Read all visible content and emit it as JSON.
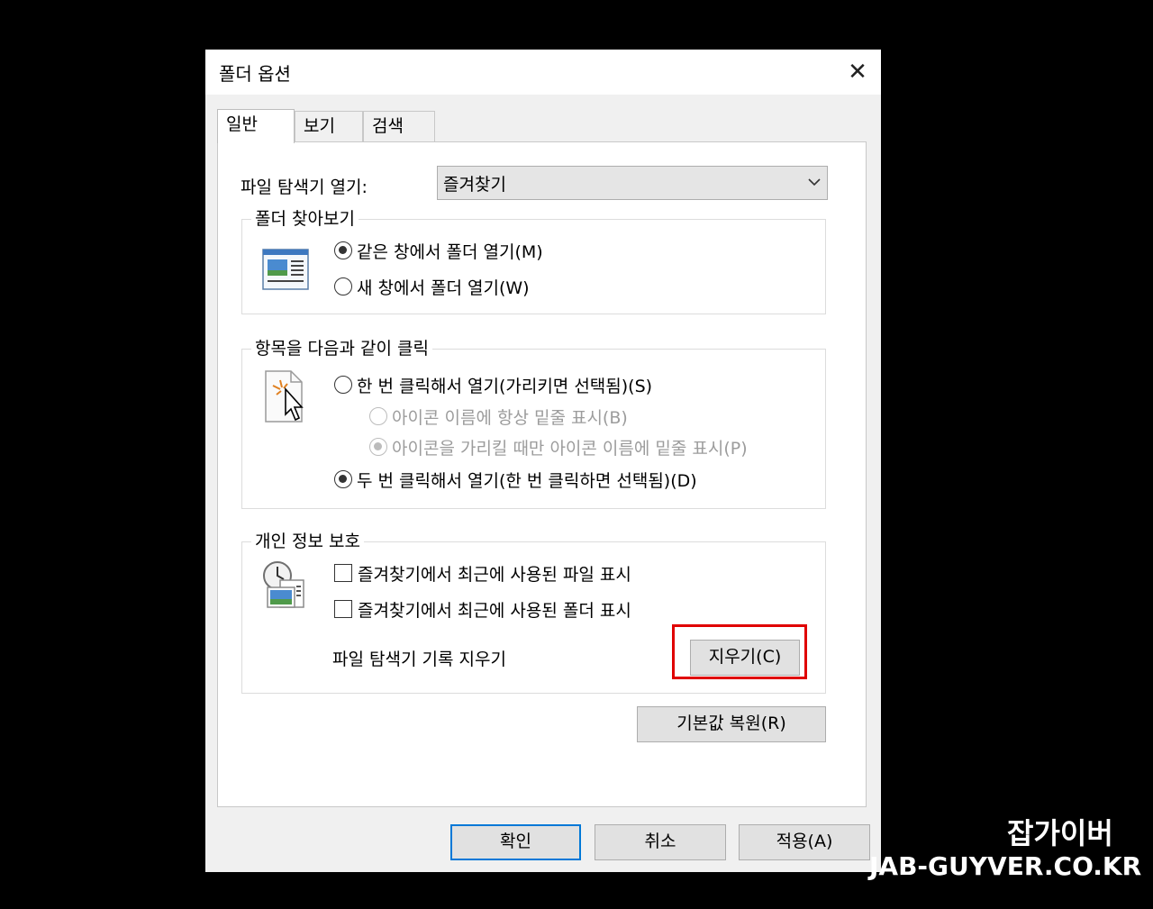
{
  "dialog": {
    "title": "폴더 옵션",
    "close_label": "✕"
  },
  "tabs": [
    "일반",
    "보기",
    "검색"
  ],
  "general": {
    "open_explorer_label": "파일 탐색기 열기:",
    "open_explorer_value": "즐겨찾기",
    "browse_group": {
      "legend": "폴더 찾아보기",
      "options": [
        "같은 창에서 폴더 열기(M)",
        "새 창에서 폴더 열기(W)"
      ],
      "selected_index": 0
    },
    "click_group": {
      "legend": "항목을 다음과 같이 클릭",
      "single_click": "한 번 클릭해서 열기(가리키면 선택됨)(S)",
      "underline_always": "아이콘 이름에 항상 밑줄 표시(B)",
      "underline_hover": "아이콘을 가리킬 때만 아이콘 이름에 밑줄 표시(P)",
      "double_click": "두 번 클릭해서 열기(한 번 클릭하면 선택됨)(D)",
      "selected": "double_click"
    },
    "privacy_group": {
      "legend": "개인 정보 보호",
      "show_recent_files": "즐겨찾기에서 최근에 사용된 파일 표시",
      "show_frequent_folders": "즐겨찾기에서 최근에 사용된 폴더 표시",
      "clear_history_label": "파일 탐색기 기록 지우기",
      "clear_button": "지우기(C)"
    },
    "restore_defaults": "기본값 복원(R)"
  },
  "footer": {
    "ok": "확인",
    "cancel": "취소",
    "apply": "적용(A)"
  },
  "watermark": {
    "line1": "잡가이버",
    "line2": "JAB-GUYVER.CO.KR"
  },
  "colors": {
    "highlight": "#e00000",
    "default_button_border": "#0078d7"
  }
}
